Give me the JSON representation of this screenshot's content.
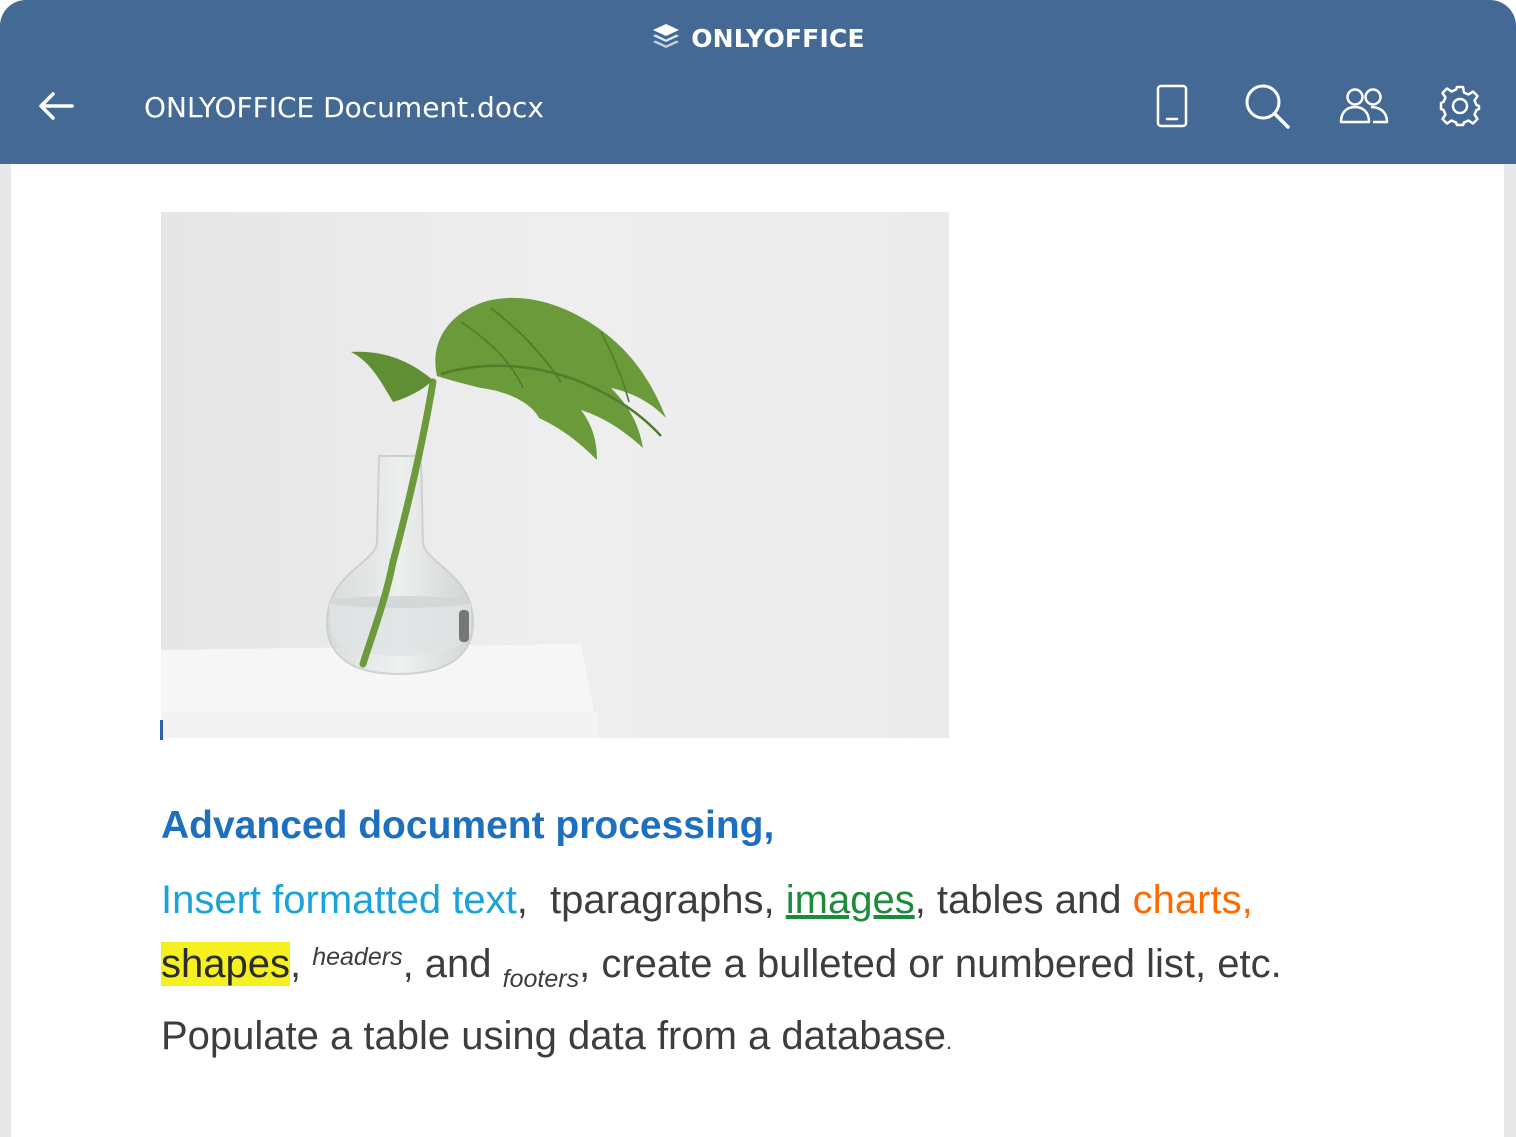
{
  "brand": {
    "name": "ONLYOFFICE",
    "icon": "layers-logo-icon"
  },
  "toolbar": {
    "back_icon": "arrow-left-icon",
    "title": "ONLYOFFICE Document.docx",
    "buttons": [
      {
        "name": "mobile-view",
        "icon": "phone-icon"
      },
      {
        "name": "search",
        "icon": "search-icon"
      },
      {
        "name": "collaboration",
        "icon": "users-icon"
      },
      {
        "name": "settings",
        "icon": "gear-icon"
      }
    ]
  },
  "colors": {
    "header": "#446995",
    "heading": "#1f6fbf",
    "link_blue": "#1aa2d9",
    "green": "#1e8a3c",
    "orange": "#ff6a00",
    "highlight": "#f5f01f",
    "body_text": "#3d3d3d"
  },
  "document": {
    "image_alt_icon": "plant-in-vase-image",
    "heading": "Advanced document processing,",
    "line1": {
      "insert": "Insert formatted text",
      "sep1": ",  ",
      "paragraphs": "tparagraphs, ",
      "images": "images",
      "tables": ", tables and ",
      "charts": "charts,"
    },
    "line2": {
      "shapes": "shapes",
      "comma": ", ",
      "headers": "headers",
      "and": ", and ",
      "footers": "footers",
      "rest": ", create a bulleted or numbered list, etc."
    },
    "line3": {
      "text": "Populate a table using data from a database",
      "dot": "."
    }
  }
}
